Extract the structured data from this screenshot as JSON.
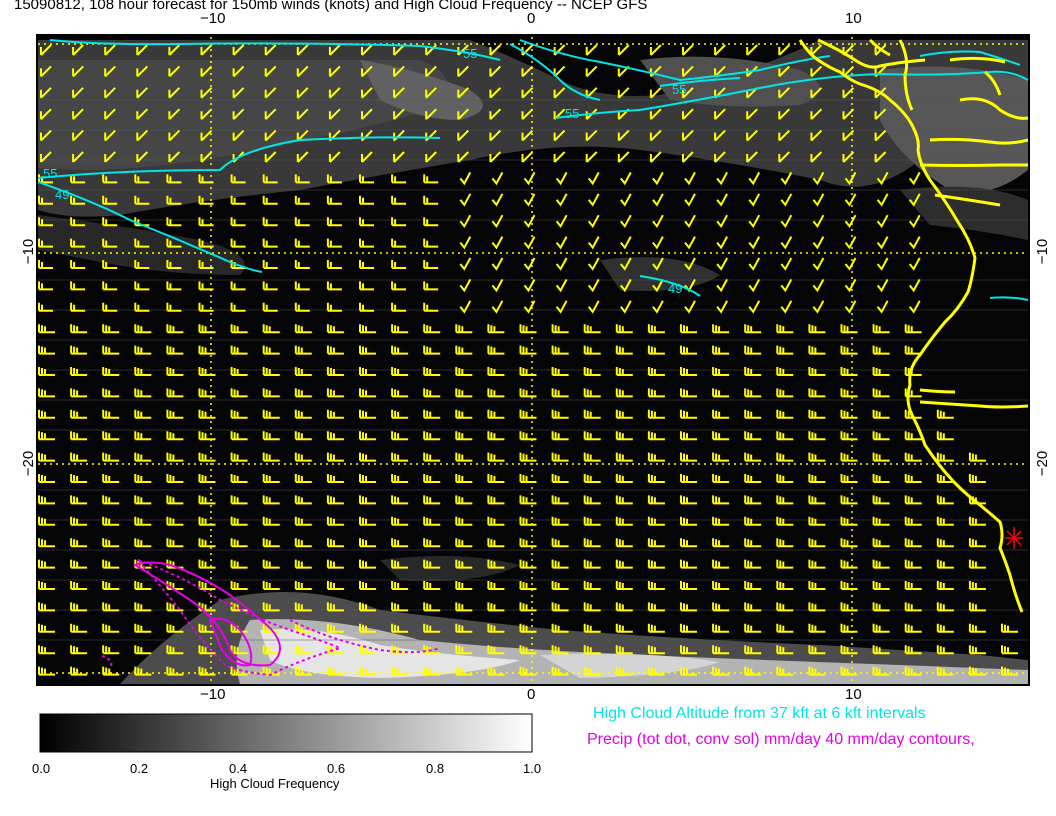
{
  "title": "15090812, 108 hour forecast for 150mb winds (knots) and High Cloud Frequency -- NCEP GFS",
  "axes": {
    "x_ticks_top": [
      "−10",
      "0",
      "10"
    ],
    "x_ticks_bottom": [
      "−10",
      "0",
      "10"
    ],
    "y_ticks_left": [
      "−10",
      "−20"
    ],
    "y_ticks_right": [
      "−10",
      "−20"
    ]
  },
  "contour_labels": [
    "55",
    "55",
    "55",
    "55",
    "49",
    "49"
  ],
  "colorbar": {
    "title": "High Cloud Frequency",
    "ticks": [
      "0.0",
      "0.2",
      "0.4",
      "0.6",
      "0.8",
      "1.0"
    ]
  },
  "legend": {
    "cloud_altitude": "High Cloud Altitude from 37 kft at 6 kft intervals",
    "precip": "Precip (tot dot, conv sol) mm/day 40 mm/day contours,"
  },
  "colors": {
    "barbs": "#ffff00",
    "coast": "#ffff00",
    "cloud_contours": "#00e5e5",
    "precip_contours": "#e600e6",
    "marker": "#ff0000"
  }
}
